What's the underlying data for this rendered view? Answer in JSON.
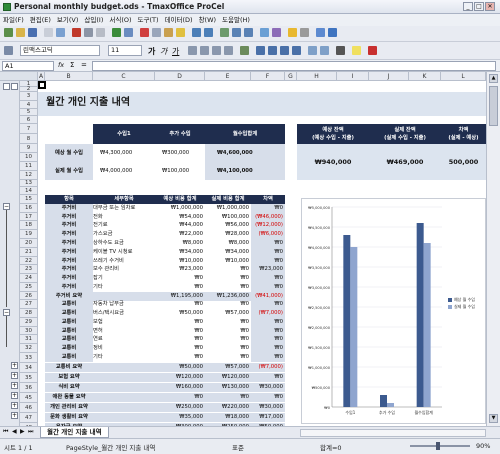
{
  "window": {
    "title": "Personal monthly budget.ods - TmaxOffice ProCel",
    "min": "_",
    "max": "□",
    "close": "✕"
  },
  "menu": [
    "파일(F)",
    "편집(E)",
    "보기(V)",
    "삽입(I)",
    "서식(O)",
    "도구(T)",
    "데이터(D)",
    "창(W)",
    "도움말(H)"
  ],
  "toolbar2": {
    "font_name": "린맥스고딕",
    "font_size": "11",
    "bold": "가",
    "italic": "가",
    "underline": "가"
  },
  "formula": {
    "cell_ref": "A1",
    "fx": "fx",
    "sum": "Σ",
    "eq": "="
  },
  "columns": [
    "A",
    "B",
    "C",
    "D",
    "E",
    "F",
    "G",
    "H",
    "I",
    "J",
    "K",
    "L"
  ],
  "rows": [
    "1",
    "2",
    "3",
    "4",
    "5",
    "6",
    "7",
    "8",
    "9",
    "10",
    "11",
    "12",
    "13",
    "14",
    "15",
    "16",
    "17",
    "18",
    "19",
    "20",
    "21",
    "22",
    "23",
    "24",
    "25",
    "26",
    "27",
    "28",
    "29",
    "30",
    "31",
    "32",
    "33",
    "34",
    "35",
    "36",
    "45",
    "46",
    "47",
    "48",
    "56",
    "57",
    "65",
    "66"
  ],
  "sheet": {
    "title": "월간 개인 지출 내역",
    "income_headers": [
      "수입1",
      "추가 수입",
      "월수입합계"
    ],
    "income_rows": [
      {
        "label": "예상 월 수입",
        "v1": "₩4,300,000",
        "v2": "₩300,000",
        "total": "₩4,600,000"
      },
      {
        "label": "실제 월 수입",
        "v1": "₩4,000,000",
        "v2": "₩100,000",
        "total": "₩4,100,000"
      }
    ],
    "balance_headers": [
      "예상 잔액\n(예상 수입 - 지출)",
      "실제 잔액\n(실제 수입 - 지출)",
      "차액\n(실제 - 예상)"
    ],
    "balance_values": [
      "₩940,000",
      "₩469,000",
      "500,000"
    ],
    "expense_headers": [
      "항목",
      "세부항목",
      "예상 비용 합계",
      "실제 비용 합계",
      "차액"
    ],
    "expense_rows": [
      [
        "주거비",
        "대무금 또는 임차료",
        "₩1,000,000",
        "₩1,000,000",
        "₩0"
      ],
      [
        "주거비",
        "전화",
        "₩54,000",
        "₩100,000",
        "(₩46,000)"
      ],
      [
        "주거비",
        "전기료",
        "₩44,000",
        "₩56,000",
        "(₩12,000)"
      ],
      [
        "주거비",
        "가스요금",
        "₩22,000",
        "₩28,000",
        "(₩6,000)"
      ],
      [
        "주거비",
        "상하수도 요금",
        "₩8,000",
        "₩8,000",
        "₩0"
      ],
      [
        "주거비",
        "케이블 TV 시청료",
        "₩34,000",
        "₩34,000",
        "₩0"
      ],
      [
        "주거비",
        "쓰레기 수거비",
        "₩10,000",
        "₩10,000",
        "₩0"
      ],
      [
        "주거비",
        "보수 관리비",
        "₩23,000",
        "₩0",
        "₩23,000"
      ],
      [
        "주거비",
        "잡기",
        "₩0",
        "₩0",
        "₩0"
      ],
      [
        "주거비",
        "기타",
        "₩0",
        "₩0",
        "₩0"
      ],
      [
        "주거비 요약",
        "",
        "₩1,195,000",
        "₩1,236,000",
        "(₩41,000)"
      ],
      [
        "교통비",
        "자동차 납부금",
        "₩0",
        "₩0",
        "₩0"
      ],
      [
        "교통비",
        "버스/택시요금",
        "₩50,000",
        "₩57,000",
        "(₩7,000)"
      ],
      [
        "교통비",
        "보험",
        "₩0",
        "₩0",
        "₩0"
      ],
      [
        "교통비",
        "면허",
        "₩0",
        "₩0",
        "₩0"
      ],
      [
        "교통비",
        "연료",
        "₩0",
        "₩0",
        "₩0"
      ],
      [
        "교통비",
        "정비",
        "₩0",
        "₩0",
        "₩0"
      ],
      [
        "교통비",
        "기타",
        "₩0",
        "₩0",
        "₩0"
      ],
      [
        "교통비 요약",
        "",
        "₩50,000",
        "₩57,000",
        "(₩7,000)"
      ],
      [
        "보험 요약",
        "",
        "₩120,000",
        "₩120,000",
        "₩0"
      ],
      [
        "식비 요약",
        "",
        "₩160,000",
        "₩130,000",
        "₩30,000"
      ],
      [
        "애완 동물 요약",
        "",
        "₩0",
        "₩0",
        "₩0"
      ],
      [
        "개인 관리비 요약",
        "",
        "₩250,000",
        "₩220,000",
        "₩30,000"
      ],
      [
        "문화 생활비 요약",
        "",
        "₩35,000",
        "₩18,000",
        "₩17,000"
      ],
      [
        "용자금 요약",
        "",
        "₩300,000",
        "₩250,000",
        "₩50,000"
      ]
    ]
  },
  "chart_data": {
    "type": "bar",
    "categories": [
      "수입1",
      "추가 수입",
      "월수입합계"
    ],
    "series": [
      {
        "name": "예상 월 수입",
        "values": [
          4300000,
          300000,
          4600000
        ],
        "color": "#3c5a8f"
      },
      {
        "name": "실제 월 수입",
        "values": [
          4000000,
          100000,
          4100000
        ],
        "color": "#8fa5cf"
      }
    ],
    "ylim": [
      0,
      5000000
    ],
    "yticks": [
      "₩5,000,000",
      "₩4,500,000",
      "₩4,000,000",
      "₩3,500,000",
      "₩3,000,000",
      "₩2,500,000",
      "₩2,000,000",
      "₩1,500,000",
      "₩1,000,000",
      "₩500,000",
      "₩0"
    ],
    "legend": "right"
  },
  "tabs": {
    "active": "월간 개인 지출 내역"
  },
  "status": {
    "sheet": "시트 1 / 1",
    "style": "PageStyle_월간 개인 지출 내역",
    "mode": "표준",
    "sum": "합계=0",
    "zoom": "90%"
  }
}
